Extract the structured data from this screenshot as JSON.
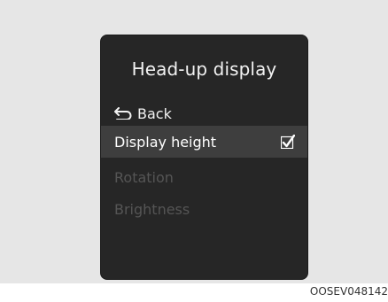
{
  "screen": {
    "title": "Head-up display",
    "menu": {
      "back_label": "Back",
      "items": [
        {
          "label": "Display height",
          "selected": true,
          "enabled": true
        },
        {
          "label": "Rotation",
          "selected": false,
          "enabled": false
        },
        {
          "label": "Brightness",
          "selected": false,
          "enabled": false
        }
      ]
    }
  },
  "icons": {
    "back": "return-arrow-icon",
    "selected_marker": "checkmark-icon"
  },
  "colors": {
    "screen_background": "#262626",
    "highlight": "#3e3e3e",
    "disabled_text": "#555555",
    "backdrop": "#e6e6e6"
  },
  "image_code": "OOSEV048142"
}
